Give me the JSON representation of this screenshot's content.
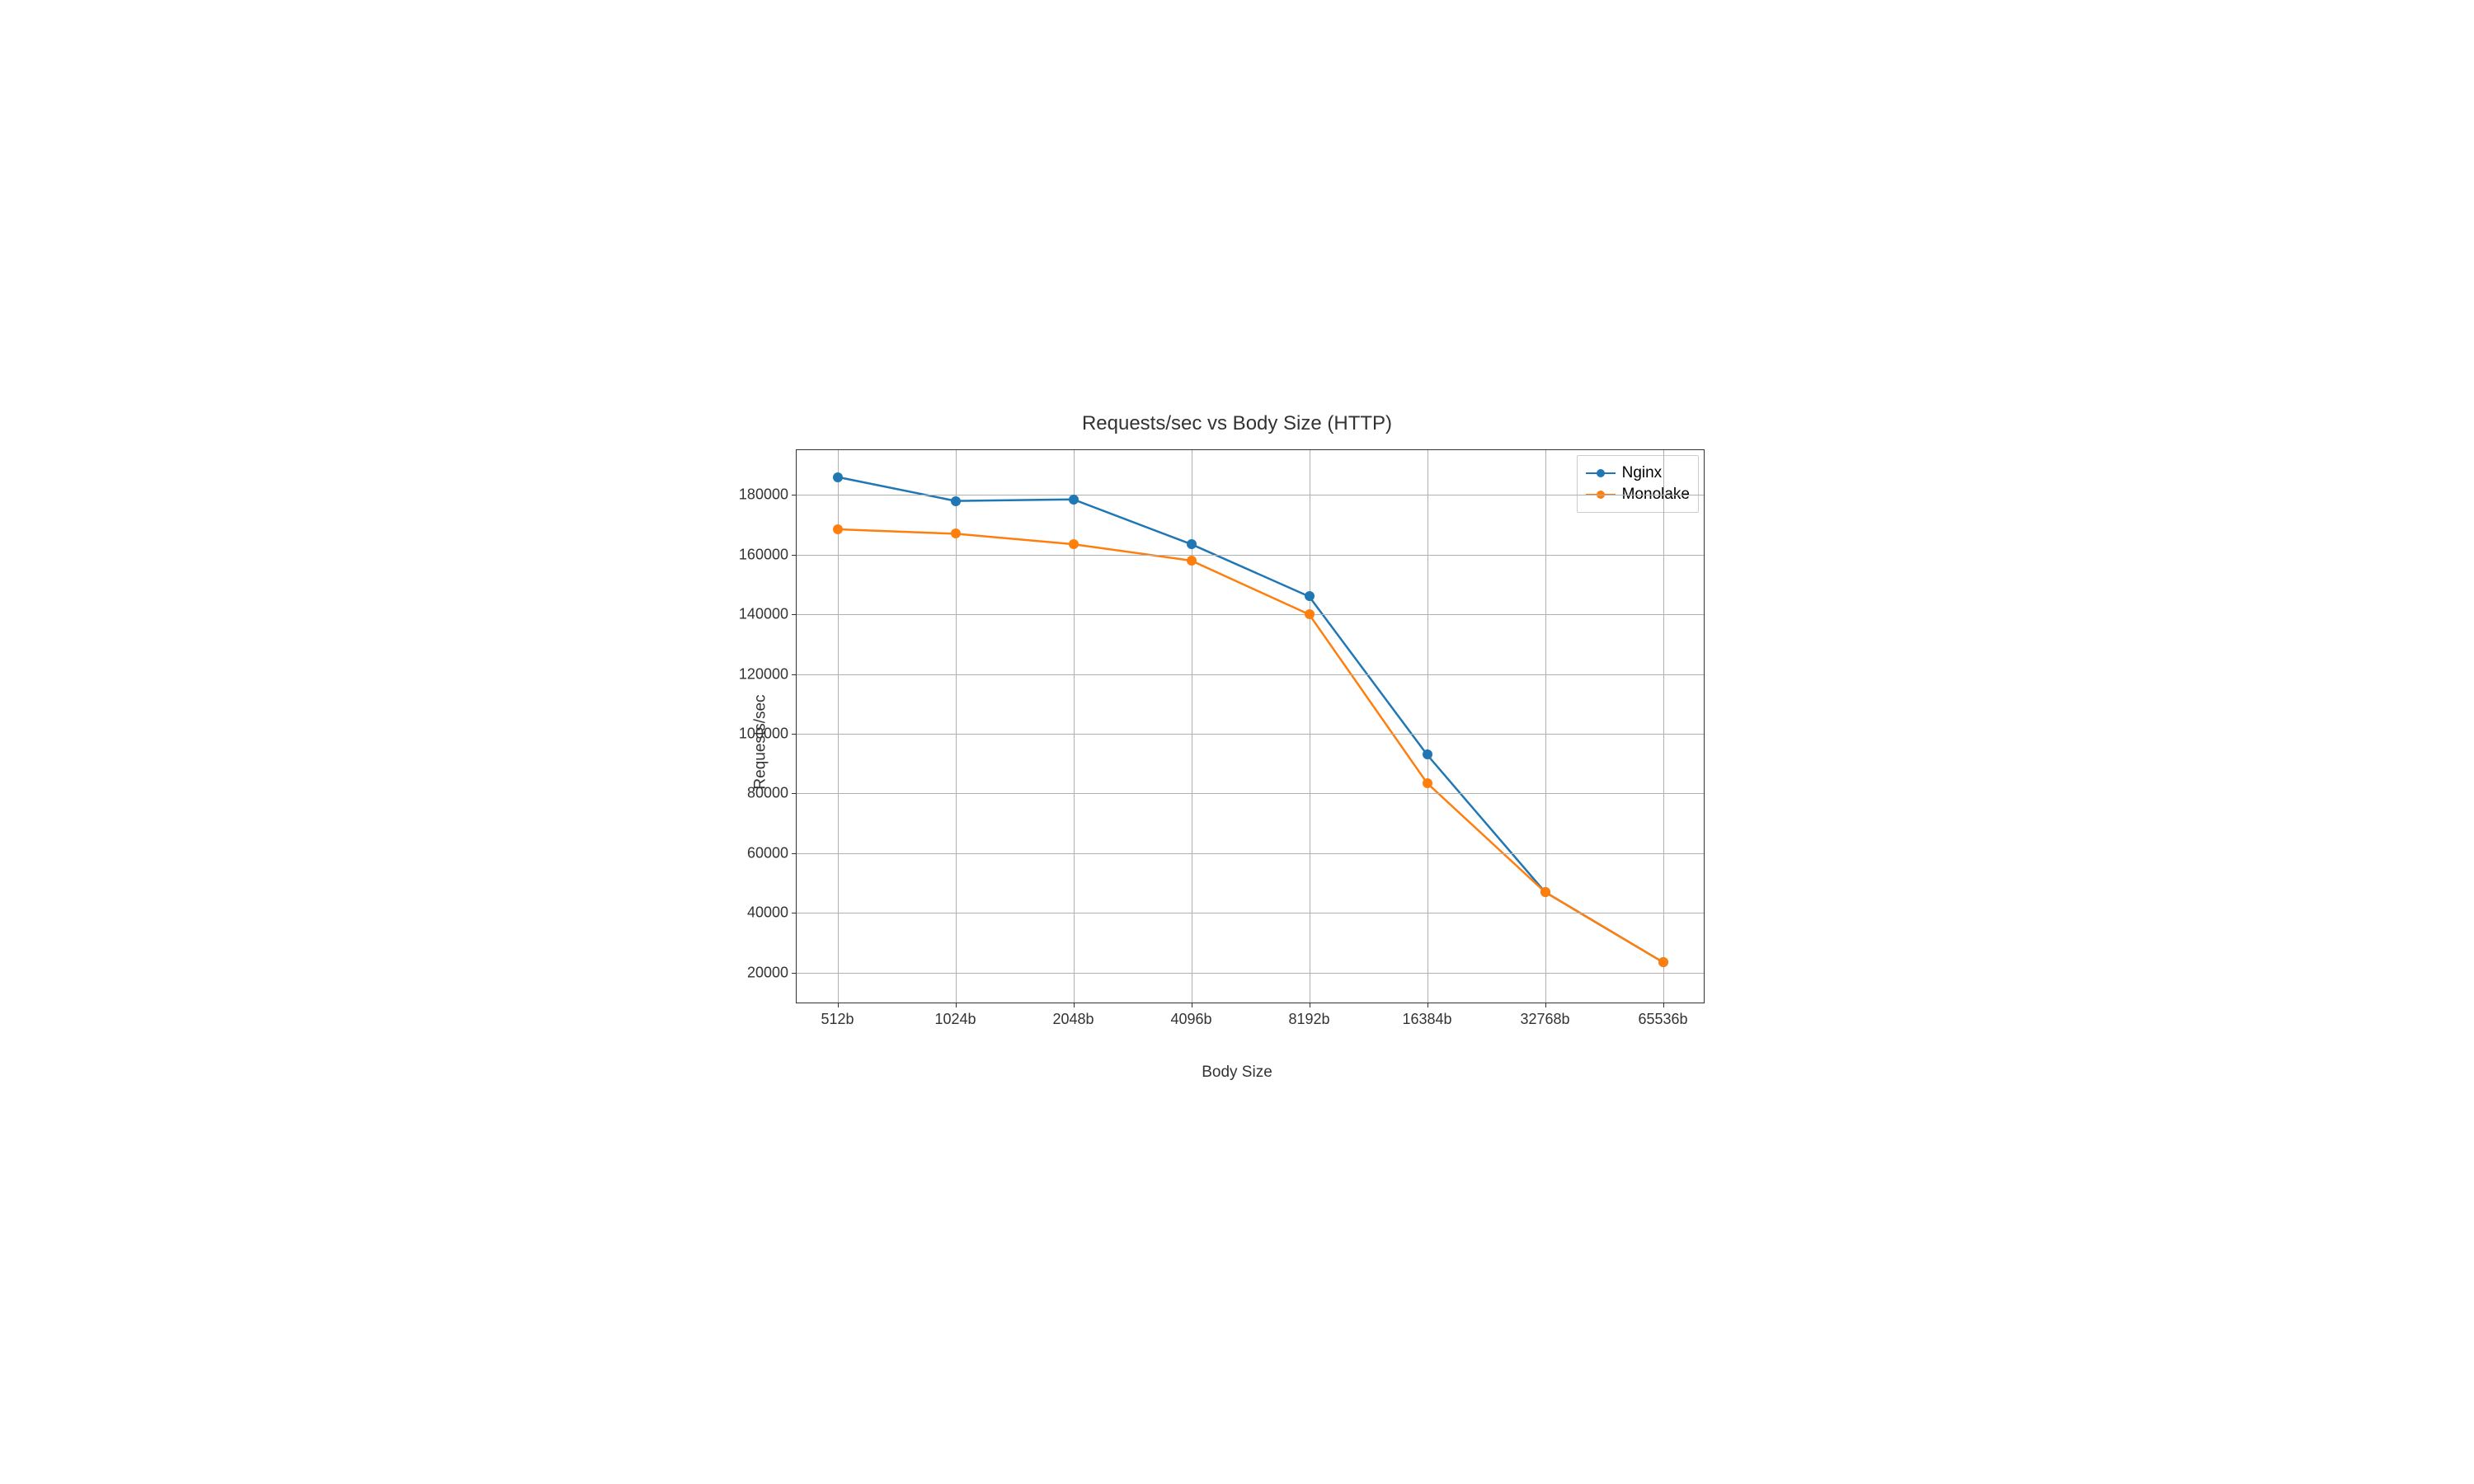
{
  "chart_data": {
    "type": "line",
    "title": "Requests/sec vs Body Size (HTTP)",
    "xlabel": "Body Size",
    "ylabel": "Requests/sec",
    "categories": [
      "512b",
      "1024b",
      "2048b",
      "4096b",
      "8192b",
      "16384b",
      "32768b",
      "65536b"
    ],
    "y_ticks": [
      20000,
      40000,
      60000,
      80000,
      100000,
      120000,
      140000,
      160000,
      180000
    ],
    "ylim": [
      10000,
      195000
    ],
    "series": [
      {
        "name": "Nginx",
        "color": "#1f77b4",
        "values": [
          186000,
          178000,
          178500,
          163500,
          146000,
          93000,
          47000,
          23500
        ]
      },
      {
        "name": "Monolake",
        "color": "#ff7f0e",
        "values": [
          168500,
          167000,
          163500,
          158000,
          140000,
          83500,
          47000,
          23500
        ]
      }
    ],
    "legend_position": "upper right",
    "grid": true
  }
}
